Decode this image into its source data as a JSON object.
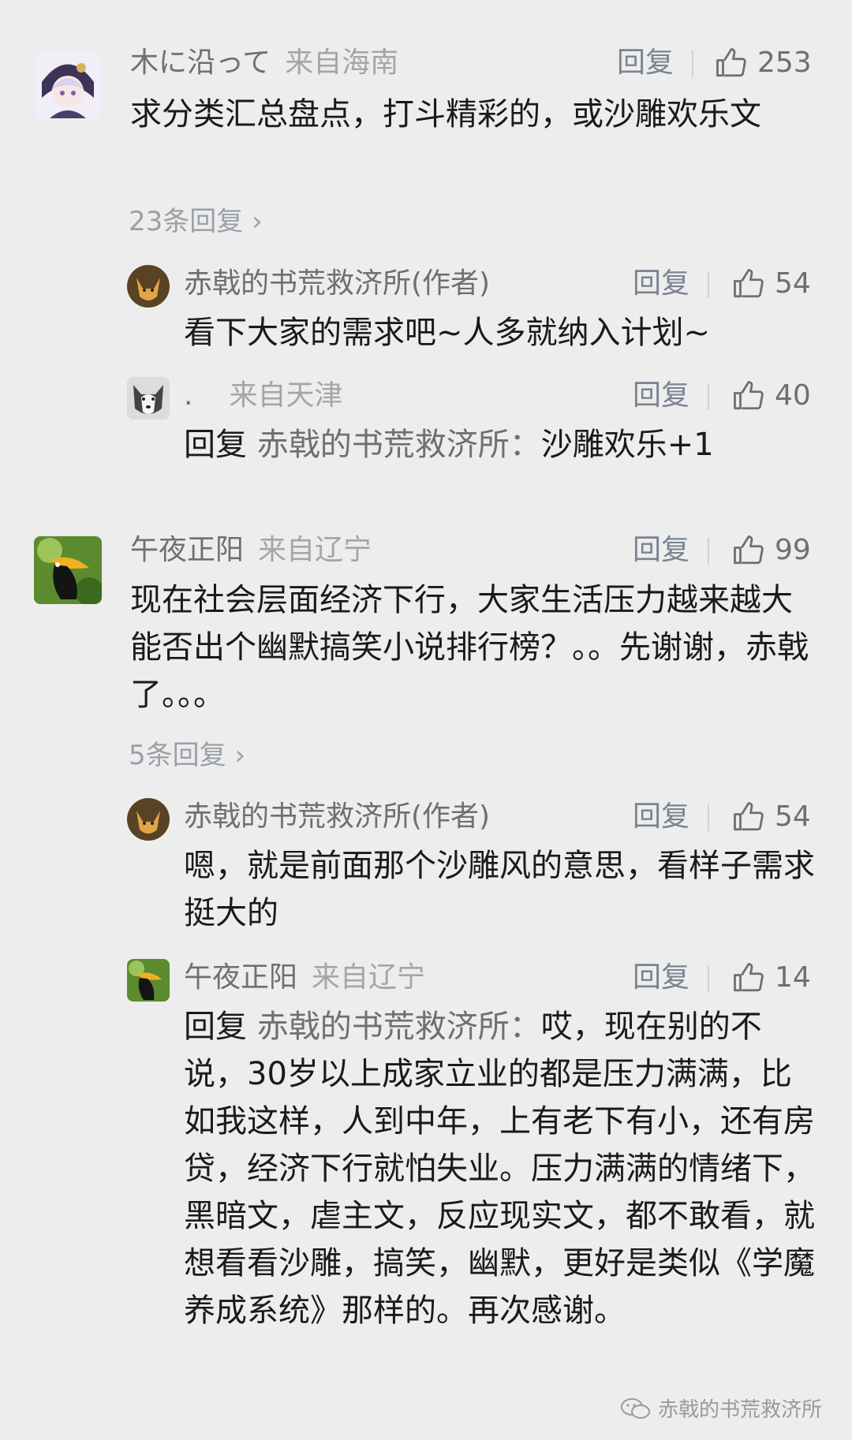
{
  "comments": [
    {
      "user": "木に沿って",
      "location": "来自海南",
      "reply_label": "回复",
      "likes": "253",
      "text": "求分类汇总盘点，打斗精彩的，或沙雕欢乐文",
      "more_replies": "23条回复",
      "replies": [
        {
          "user": "赤戟的书荒救济所(作者)",
          "location": "",
          "reply_label": "回复",
          "likes": "54",
          "text": "看下大家的需求吧~人多就纳入计划~"
        },
        {
          "user": ".",
          "location": "来自天津",
          "reply_label": "回复",
          "likes": "40",
          "reply_prefix": "回复",
          "reply_to": "赤戟的书荒救济所：",
          "text": "沙雕欢乐+1"
        }
      ]
    },
    {
      "user": "午夜正阳",
      "location": "来自辽宁",
      "reply_label": "回复",
      "likes": "99",
      "text": "现在社会层面经济下行，大家生活压力越来越大能否出个幽默搞笑小说排行榜？。。先谢谢，赤戟了。。。",
      "more_replies": "5条回复",
      "replies": [
        {
          "user": "赤戟的书荒救济所(作者)",
          "location": "",
          "reply_label": "回复",
          "likes": "54",
          "text": "嗯，就是前面那个沙雕风的意思，看样子需求挺大的"
        },
        {
          "user": "午夜正阳",
          "location": "来自辽宁",
          "reply_label": "回复",
          "likes": "14",
          "reply_prefix": "回复",
          "reply_to": "赤戟的书荒救济所：",
          "text": "哎，现在别的不说，30岁以上成家立业的都是压力满满，比如我这样，人到中年，上有老下有小，还有房贷，经济下行就怕失业。压力满满的情绪下，黑暗文，虐主文，反应现实文，都不敢看，就想看看沙雕，搞笑，幽默，更好是类似《学魔养成系统》那样的。再次感谢。"
        }
      ]
    }
  ],
  "watermark": "赤戟的书荒救济所",
  "colors": {
    "background": "#ededed",
    "text": "#1a1a1a",
    "muted": "#6f6f6f",
    "link": "#7a8491"
  }
}
